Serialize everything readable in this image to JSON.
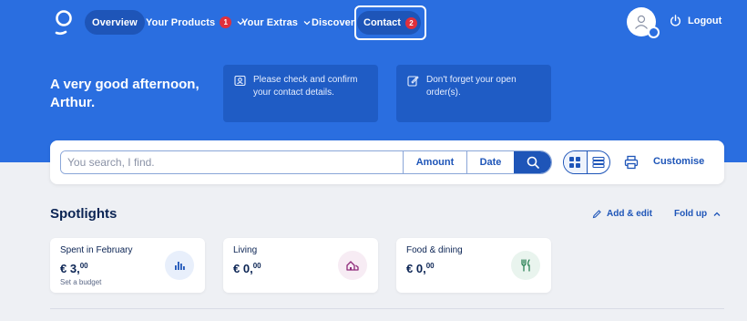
{
  "nav": {
    "items": [
      {
        "label": "Overview"
      },
      {
        "label": "Your Products",
        "badge": "1"
      },
      {
        "label": "Your Extras"
      },
      {
        "label": "Discover"
      },
      {
        "label": "Contact",
        "badge": "2"
      }
    ],
    "logout_label": "Logout",
    "icons": {
      "logo": "logo-icon",
      "avatar": "user-icon",
      "logout": "power-icon"
    }
  },
  "hero": {
    "greeting": "A very good afternoon, Arthur.",
    "notices": [
      {
        "text": "Please check and confirm your contact details.",
        "icon": "contact-card-icon"
      },
      {
        "text": "Don't forget your open order(s).",
        "icon": "edit-note-icon"
      }
    ]
  },
  "search": {
    "placeholder": "You search, I find.",
    "amount_label": "Amount",
    "date_label": "Date",
    "customise_label": "Customise"
  },
  "spotlights": {
    "title": "Spotlights",
    "add_edit_label": "Add & edit",
    "fold_up_label": "Fold up",
    "cards": [
      {
        "label": "Spent in February",
        "currency": "€",
        "amount_int": "3,",
        "amount_dec": "00",
        "sub": "Set a budget",
        "icon": "bar-chart-icon"
      },
      {
        "label": "Living",
        "currency": "€",
        "amount_int": "0,",
        "amount_dec": "00",
        "icon": "house-icon"
      },
      {
        "label": "Food & dining",
        "currency": "€",
        "amount_int": "0,",
        "amount_dec": "00",
        "icon": "fork-knife-icon"
      }
    ]
  },
  "colors": {
    "brand_blue": "#2a6ee0",
    "dark_blue": "#1e55b8",
    "badge_red": "#e0303c",
    "text_navy": "#0b2454"
  }
}
